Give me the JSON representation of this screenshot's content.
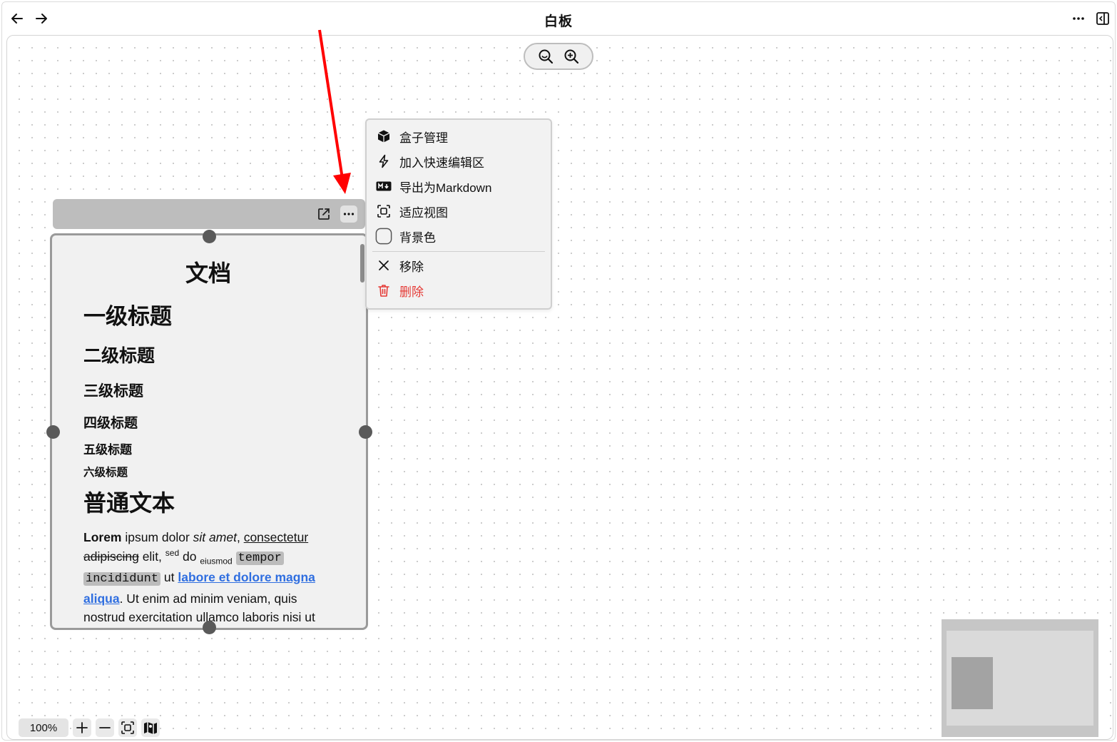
{
  "window": {
    "title": "白板"
  },
  "toolbar": {
    "back_icon": "arrow-left-icon",
    "forward_icon": "arrow-right-icon",
    "more_icon": "more-horizontal-icon",
    "sidebar_icon": "sidebar-toggle-icon"
  },
  "zoom_controls": {
    "zoom_out_icon": "zoom-out-icon",
    "zoom_in_icon": "zoom-in-icon"
  },
  "card": {
    "doc_title": "文档",
    "headings": [
      "一级标题",
      "二级标题",
      "三级标题",
      "四级标题",
      "五级标题",
      "六级标题"
    ],
    "normal_text_heading": "普通文本",
    "paragraph": {
      "bold": "Lorem",
      "t1": " ipsum dolor ",
      "italic": "sit amet",
      "t2": ", ",
      "underline": "consectetur",
      "strike": "adipiscing",
      "t3": " elit, ",
      "sup": "sed",
      "t4": " do ",
      "sub": "eiusmod",
      "code1": "tempor ",
      "code2": "incididunt",
      "t5": " ut ",
      "link1": "labore et dolore magna ",
      "link2": "aliqua",
      "t6": ". Ut enim ad minim veniam, quis nostrud exercitation ullamco laboris nisi ut"
    }
  },
  "context_menu": {
    "items": [
      {
        "label": "盒子管理",
        "icon": "box-icon"
      },
      {
        "label": "加入快速编辑区",
        "icon": "lightning-icon"
      },
      {
        "label": "导出为Markdown",
        "icon": "markdown-icon"
      },
      {
        "label": "适应视图",
        "icon": "fit-view-icon"
      },
      {
        "label": "背景色",
        "icon": "color-swatch-icon"
      },
      {
        "label": "移除",
        "icon": "close-icon"
      },
      {
        "label": "删除",
        "icon": "trash-icon"
      }
    ],
    "danger_color": "#e53935"
  },
  "bottom_bar": {
    "zoom_level": "100%"
  },
  "colors": {
    "annotation_arrow": "#ff0000"
  }
}
